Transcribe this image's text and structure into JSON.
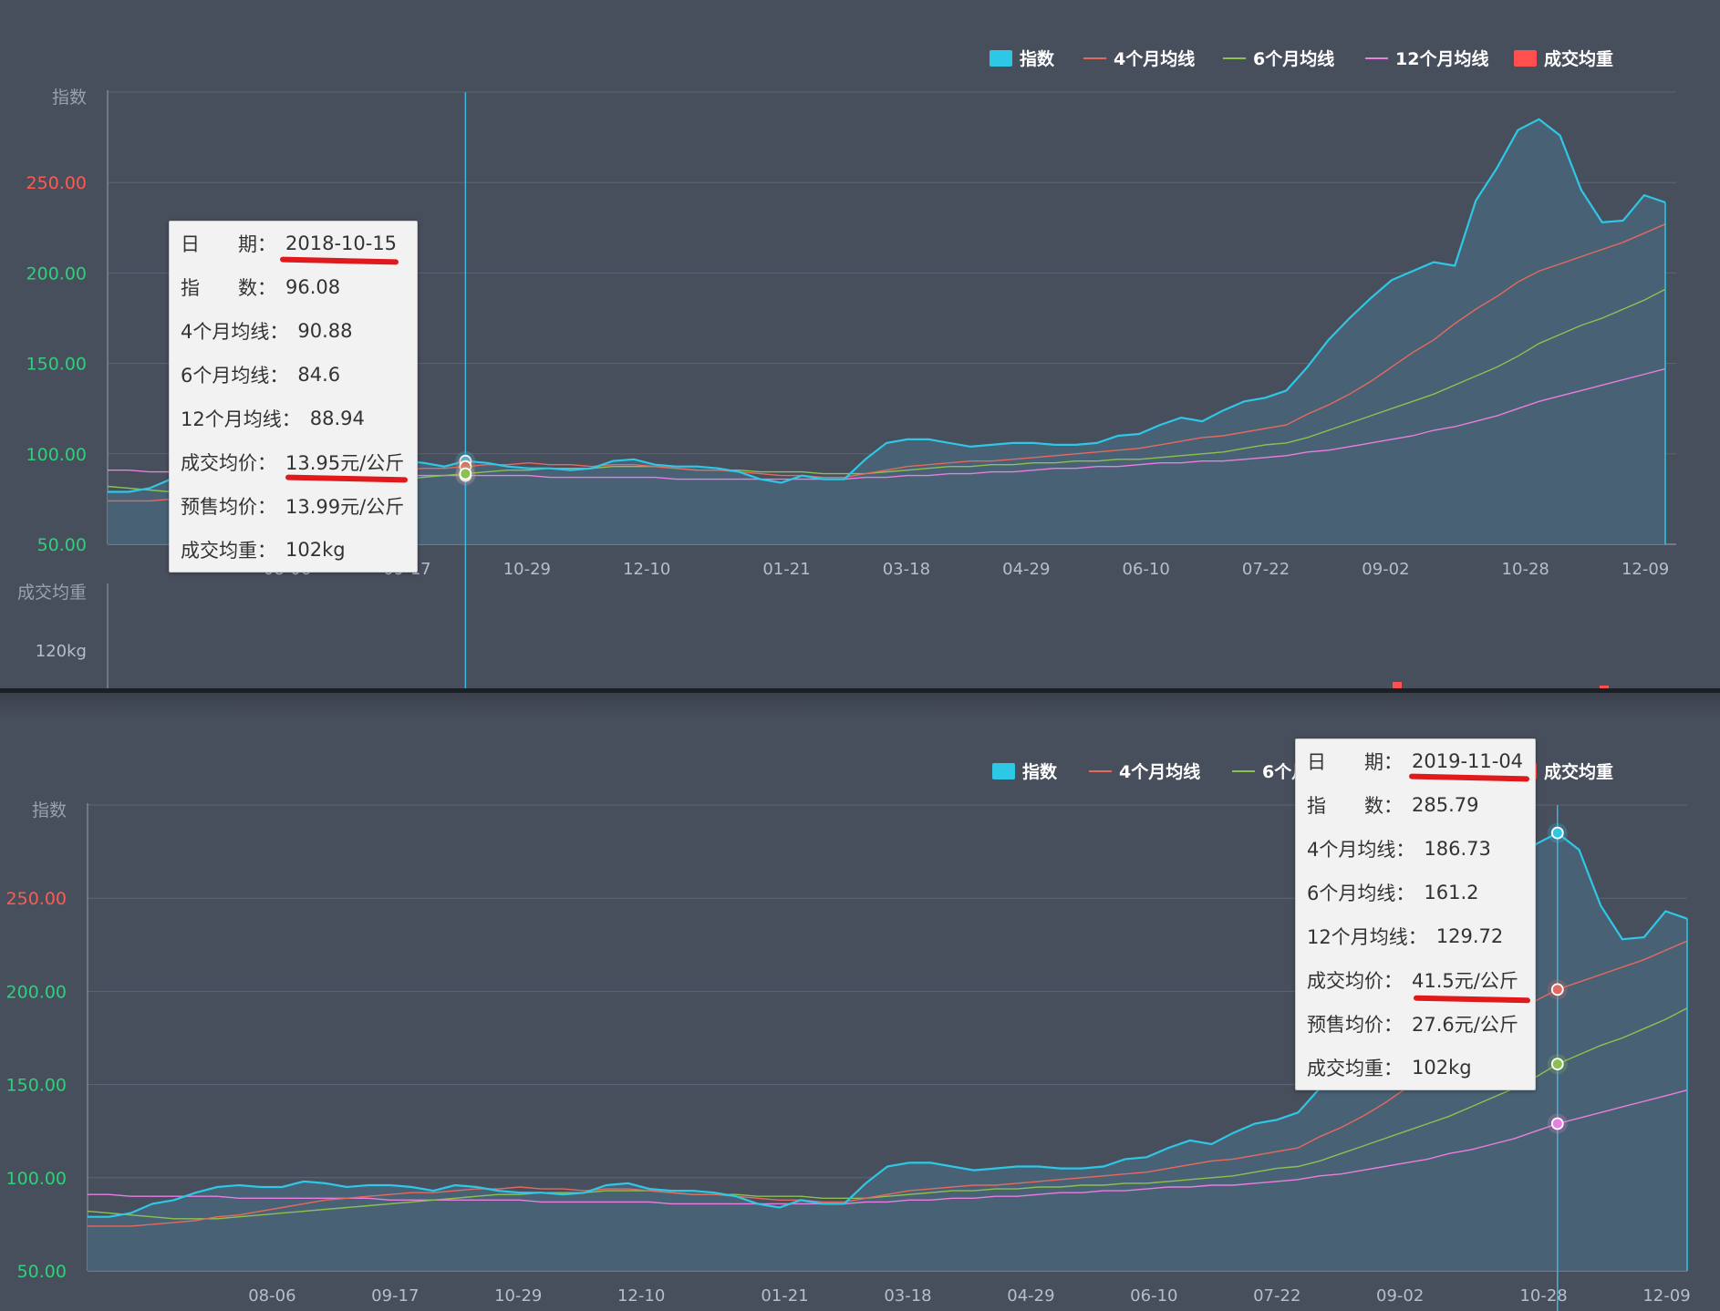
{
  "chart_data": [
    {
      "type": "area",
      "title": "",
      "x_ticks": [
        "08-06",
        "09-17",
        "10-29",
        "12-10",
        "01-21",
        "03-18",
        "04-29",
        "06-10",
        "07-22",
        "09-02",
        "10-28",
        "12-09"
      ],
      "y_label": "指数",
      "y_ticks": [
        "250.00",
        "200.00",
        "150.00",
        "100.00",
        "50.00"
      ],
      "ylim": [
        50,
        300
      ],
      "legend": [
        "指数",
        "4个月均线",
        "6个月均线",
        "12个月均线",
        "成交均重"
      ],
      "legend_position": "top-right",
      "colors": {
        "index": "#2ec7e6",
        "ma4": "#e46a5f",
        "ma6": "#8cc152",
        "ma12": "#e87ee0",
        "volume": "#ff4f4f"
      },
      "series": [
        {
          "name": "指数",
          "values": [
            79,
            79,
            81,
            86,
            88,
            92,
            95,
            96,
            95,
            95,
            98,
            97,
            95,
            96,
            96,
            95,
            93,
            96,
            95,
            93,
            92,
            92,
            91,
            92,
            96,
            97,
            94,
            93,
            93,
            92,
            90,
            86,
            84,
            88,
            86,
            86,
            97,
            106,
            108,
            108,
            106,
            104,
            105,
            106,
            106,
            105,
            105,
            106,
            110,
            111,
            116,
            120,
            118,
            124,
            129,
            131,
            135,
            148,
            163,
            175,
            186,
            196,
            201,
            206,
            204,
            240,
            258,
            279,
            285,
            276,
            246,
            228,
            229,
            243,
            239
          ]
        },
        {
          "name": "4个月均线",
          "values": [
            74,
            74,
            74,
            75,
            76,
            77,
            79,
            80,
            82,
            84,
            86,
            88,
            89,
            90,
            91,
            92,
            92,
            93,
            94,
            94,
            95,
            94,
            94,
            93,
            94,
            94,
            93,
            92,
            91,
            91,
            90,
            89,
            88,
            88,
            87,
            87,
            89,
            91,
            93,
            94,
            95,
            96,
            96,
            97,
            98,
            99,
            100,
            101,
            102,
            103,
            105,
            107,
            109,
            110,
            112,
            114,
            116,
            122,
            127,
            133,
            140,
            148,
            156,
            163,
            172,
            180,
            187,
            195,
            201,
            205,
            209,
            213,
            217,
            222,
            227
          ]
        },
        {
          "name": "6个月均线",
          "values": [
            82,
            81,
            80,
            79,
            78,
            78,
            78,
            79,
            80,
            81,
            82,
            83,
            84,
            85,
            86,
            87,
            88,
            89,
            90,
            91,
            91,
            92,
            92,
            92,
            93,
            93,
            93,
            92,
            91,
            91,
            91,
            90,
            90,
            90,
            89,
            89,
            89,
            90,
            91,
            92,
            93,
            93,
            94,
            94,
            95,
            95,
            96,
            96,
            97,
            97,
            98,
            99,
            100,
            101,
            103,
            105,
            106,
            109,
            113,
            117,
            121,
            125,
            129,
            133,
            138,
            143,
            148,
            154,
            161,
            166,
            171,
            175,
            180,
            185,
            191
          ]
        },
        {
          "name": "12个月均线",
          "values": [
            91,
            91,
            90,
            90,
            90,
            90,
            90,
            89,
            89,
            89,
            89,
            89,
            89,
            89,
            88,
            88,
            88,
            88,
            88,
            88,
            88,
            87,
            87,
            87,
            87,
            87,
            87,
            86,
            86,
            86,
            86,
            86,
            86,
            86,
            86,
            86,
            87,
            87,
            88,
            88,
            89,
            89,
            90,
            90,
            91,
            92,
            92,
            93,
            93,
            94,
            95,
            95,
            96,
            96,
            97,
            98,
            99,
            101,
            102,
            104,
            106,
            108,
            110,
            113,
            115,
            118,
            121,
            125,
            129,
            132,
            135,
            138,
            141,
            144,
            147
          ]
        }
      ],
      "volume_axis": {
        "label": "成交均重",
        "tick": "120kg"
      }
    }
  ],
  "legend_labels": {
    "index": "指数",
    "ma4": "4个月均线",
    "ma6": "6个月均线",
    "ma12": "12个月均线",
    "volume": "成交均重"
  },
  "tooltip_top": {
    "rows": [
      {
        "label": "日　　期：",
        "value": "2018-10-15"
      },
      {
        "label": "指　　数：",
        "value": "96.08"
      },
      {
        "label": "4个月均线：",
        "value": "90.88"
      },
      {
        "label": "6个月均线：",
        "value": "84.6"
      },
      {
        "label": "12个月均线：",
        "value": "88.94"
      },
      {
        "label": "成交均价：",
        "value": "13.95元/公斤"
      },
      {
        "label": "预售均价：",
        "value": "13.99元/公斤"
      },
      {
        "label": "成交均重：",
        "value": "102kg"
      }
    ]
  },
  "tooltip_bottom": {
    "rows": [
      {
        "label": "日　　期：",
        "value": "2019-11-04"
      },
      {
        "label": "指　　数：",
        "value": "285.79"
      },
      {
        "label": "4个月均线：",
        "value": "186.73"
      },
      {
        "label": "6个月均线：",
        "value": "161.2"
      },
      {
        "label": "12个月均线：",
        "value": "129.72"
      },
      {
        "label": "成交均价：",
        "value": "41.5元/公斤"
      },
      {
        "label": "预售均价：",
        "value": "27.6元/公斤"
      },
      {
        "label": "成交均重：",
        "value": "102kg"
      }
    ]
  }
}
